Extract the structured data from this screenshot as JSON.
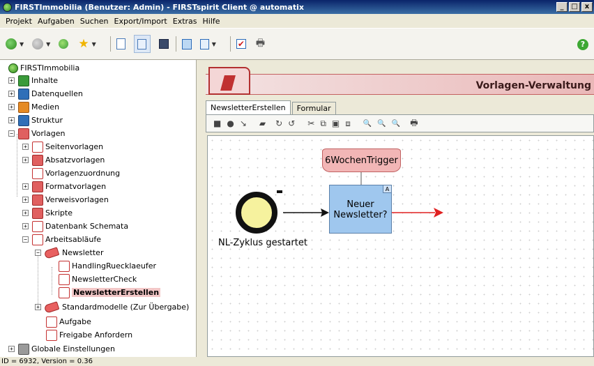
{
  "window": {
    "title": "FIRSTImmobilia (Benutzer: Admin) - FIRSTspirit Client @ automatix",
    "minimize": "_",
    "maximize": "□",
    "close": "x"
  },
  "menubar": {
    "items": [
      "Projekt",
      "Aufgaben",
      "Suchen",
      "Export/Import",
      "Extras",
      "Hilfe"
    ]
  },
  "toolbar": {
    "icons": [
      "back-icon",
      "forward-icon",
      "sync-icon",
      "favorites-star-icon",
      "new-page-icon",
      "edit-icon",
      "save-icon",
      "preview-icon",
      "release-icon",
      "check-icon",
      "print-icon",
      "help-icon"
    ],
    "help_label": "?"
  },
  "tree": {
    "root": "FIRSTImmobilia",
    "items": [
      {
        "label": "Inhalte",
        "icon": "content-icon"
      },
      {
        "label": "Datenquellen",
        "icon": "datasources-icon"
      },
      {
        "label": "Medien",
        "icon": "media-icon"
      },
      {
        "label": "Struktur",
        "icon": "structure-icon"
      },
      {
        "label": "Vorlagen",
        "icon": "templates-icon"
      },
      {
        "label": "Seitenvorlagen",
        "icon": "page-templates-icon"
      },
      {
        "label": "Absatzvorlagen",
        "icon": "section-templates-icon"
      },
      {
        "label": "Vorlagenzuordnung",
        "icon": "template-mapping-icon"
      },
      {
        "label": "Formatvorlagen",
        "icon": "format-templates-icon"
      },
      {
        "label": "Verweisvorlagen",
        "icon": "link-templates-icon"
      },
      {
        "label": "Skripte",
        "icon": "scripts-icon"
      },
      {
        "label": "Datenbank Schemata",
        "icon": "database-schema-icon"
      },
      {
        "label": "Arbeitsabläufe",
        "icon": "workflows-icon"
      },
      {
        "label": "Newsletter",
        "icon": "folder-tag-icon"
      },
      {
        "label": "HandlingRuecklaeufer",
        "icon": "workflow-icon"
      },
      {
        "label": "NewsletterCheck",
        "icon": "workflow-icon"
      },
      {
        "label": "NewsletterErstellen",
        "icon": "workflow-icon"
      },
      {
        "label": "Standardmodelle (Zur Übergabe)",
        "icon": "folder-tag-icon"
      },
      {
        "label": "Aufgabe",
        "icon": "workflow-icon"
      },
      {
        "label": "Freigabe Anfordern",
        "icon": "workflow-icon"
      },
      {
        "label": "Globale Einstellungen",
        "icon": "global-settings-icon"
      }
    ]
  },
  "status": {
    "text": "ID = 6932, Version = 0.36"
  },
  "main": {
    "header_title": "Vorlagen-Verwaltung",
    "tabs": [
      "NewsletterErstellen",
      "Formular"
    ],
    "editor_toolbar": [
      "■",
      "●",
      "↘",
      "▰",
      "↻",
      "↺",
      "✂",
      "⧉",
      "▣",
      "⧈",
      "🔍",
      "🔍",
      "🔍",
      "🖶"
    ]
  },
  "workflow": {
    "trigger_label": "6WochenTrigger",
    "start_label": "NL-Zyklus gestartet",
    "task_label_line1": "Neuer",
    "task_label_line2": "Newsletter?",
    "task_badge": "A"
  },
  "colors": {
    "titlebar": "#0a246a",
    "trigger_fill": "#f2b6b6",
    "task_fill": "#9fc7ee",
    "start_fill": "#f6f29e",
    "arrow_red": "#e02020",
    "selected_bg": "#f2c7c7"
  }
}
